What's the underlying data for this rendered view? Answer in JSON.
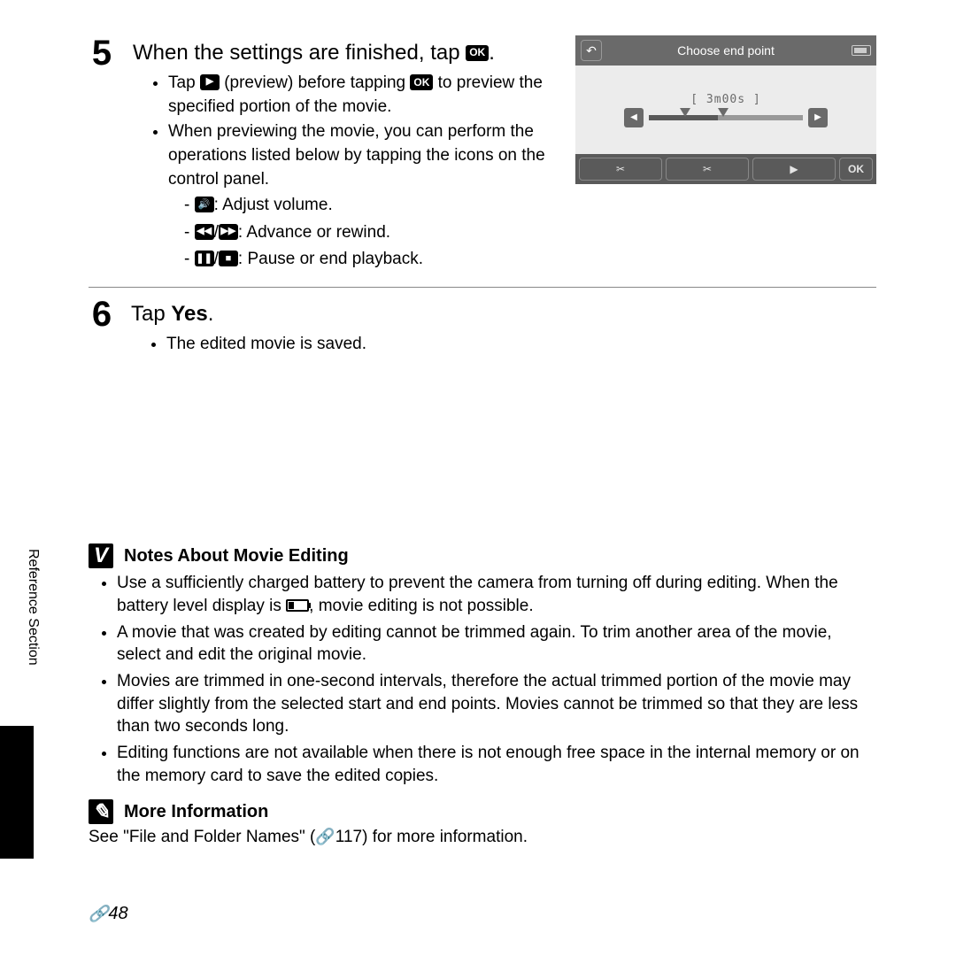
{
  "step5": {
    "number": "5",
    "heading_before": "When the settings are finished, tap ",
    "heading_after": ".",
    "ok_icon_label": "OK",
    "bullet1_before": "Tap ",
    "bullet1_mid": " (preview) before tapping ",
    "bullet1_after": " to preview the specified portion of the movie.",
    "preview_icon": "▶",
    "bullet2": "When previewing the movie, you can perform the operations listed below by tapping the icons on the control panel.",
    "sub1_icon": "🔊",
    "sub1_text": ": Adjust volume.",
    "sub2_icon1": "◀◀",
    "sub2_icon2": "▶▶",
    "sub2_text": ": Advance or rewind.",
    "sub3_icon1": "❚❚",
    "sub3_icon2": "■",
    "sub3_text": ": Pause or end playback."
  },
  "screen": {
    "title": "Choose end point",
    "time": "3m00s",
    "back": "↶",
    "prev": "◀",
    "next": "▶",
    "cut1": "✂",
    "cut2": "✂",
    "play": "▶",
    "ok": "OK"
  },
  "step6": {
    "number": "6",
    "heading_before": "Tap ",
    "heading_bold": "Yes",
    "heading_after": ".",
    "bullet1": "The edited movie is saved."
  },
  "notes": {
    "icon": "V",
    "heading": "Notes About Movie Editing",
    "b1_before": "Use a sufficiently charged battery to prevent the camera from turning off during editing. When the battery level display is ",
    "b1_after": ", movie editing is not possible.",
    "b2": "A movie that was created by editing cannot be trimmed again. To trim another area of the movie, select and edit the original movie.",
    "b3": "Movies are trimmed in one-second intervals, therefore the actual trimmed portion of the movie may differ slightly from the selected start and end points. Movies cannot be trimmed so that they are less than two seconds long.",
    "b4": "Editing functions are not available when there is not enough free space in the internal memory or on the memory card to save the edited copies."
  },
  "more": {
    "icon": "✎",
    "heading": "More Information",
    "text_before": "See \"File and Folder Names\" (",
    "link_icon": "⬤⬤",
    "text_page": "117) for more information."
  },
  "side_label": "Reference Section",
  "page_number": "48",
  "page_link_icon": "⬤⬤"
}
